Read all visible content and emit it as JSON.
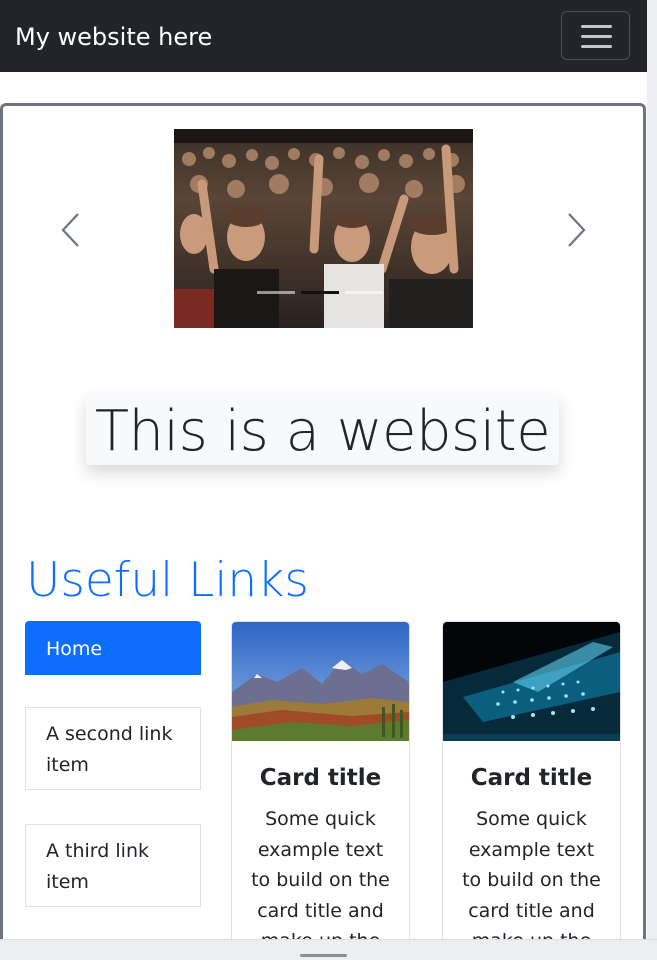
{
  "navbar": {
    "brand": "My website here",
    "toggler_icon": "hamburger-icon",
    "background": "#212529"
  },
  "carousel": {
    "prev_icon": "chevron-left-icon",
    "next_icon": "chevron-right-icon",
    "slide_count": 3,
    "active_index": 1,
    "image": "concert-crowd-image"
  },
  "hero": {
    "text": "This is a website"
  },
  "links": {
    "title": "Useful Links",
    "title_color": "#0d6efd",
    "items": [
      {
        "label": "Home",
        "active": true
      },
      {
        "label": "A second link item",
        "active": false
      },
      {
        "label": "A third link item",
        "active": false
      }
    ]
  },
  "cards": [
    {
      "image": "mountain-landscape-image",
      "title": "Card title",
      "text": "Some quick example text to build on the card title and make up the"
    },
    {
      "image": "keyboard-light-image",
      "title": "Card title",
      "text": "Some quick example text to build on the card title and make up the"
    }
  ],
  "colors": {
    "accent": "#0d6efd",
    "frame_border": "#6c757d",
    "hero_bg": "#f8f9fa"
  }
}
